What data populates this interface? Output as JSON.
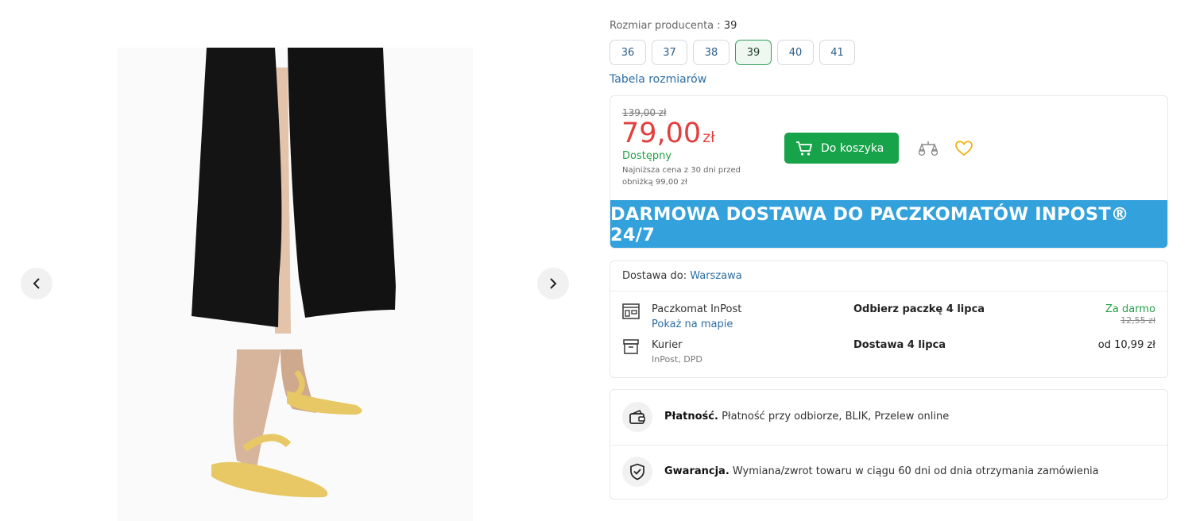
{
  "gallery": {
    "prev_label": "prev",
    "next_label": "next"
  },
  "product": {
    "size_label": "Rozmiar producenta",
    "size_selected": "39",
    "sizes": [
      "36",
      "37",
      "38",
      "39",
      "40",
      "41"
    ],
    "size_table_link": "Tabela rozmiarów",
    "old_price": "139,00 zł",
    "price_value": "79,00",
    "price_currency": "zł",
    "availability": "Dostępny",
    "lowest_price_note": "Najniższa cena z 30 dni przed obniżką 99,00 zł",
    "cart_button": "Do koszyka",
    "banner": "DARMOWA DOSTAWA DO PACZKOMATÓW INPOST® 24/7"
  },
  "shipping": {
    "delivery_to_label": "Dostawa do:",
    "city": "Warszawa",
    "options": [
      {
        "name": "Paczkomat InPost",
        "link": "Pokaż na mapie",
        "when": "Odbierz paczkę 4 lipca",
        "price": "Za darmo",
        "old_price": "12,55 zł",
        "icon": "locker-icon"
      },
      {
        "name": "Kurier",
        "sub": "InPost, DPD",
        "when": "Dostawa 4 lipca",
        "price": "od 10,99 zł",
        "icon": "courier-box-icon"
      }
    ]
  },
  "info": {
    "payment_title": "Płatność.",
    "payment_text": "Płatność przy odbiorze, BLIK, Przelew online",
    "warranty_title": "Gwarancja.",
    "warranty_text": "Wymiana/zwrot towaru w ciągu 60 dni od dnia otrzymania zamówienia"
  },
  "colors": {
    "accent_green": "#17a34a",
    "price_red": "#e23f3f",
    "banner_blue": "#33a1dc",
    "link_blue": "#2c6da3",
    "heart_yellow": "#f2b51a"
  }
}
